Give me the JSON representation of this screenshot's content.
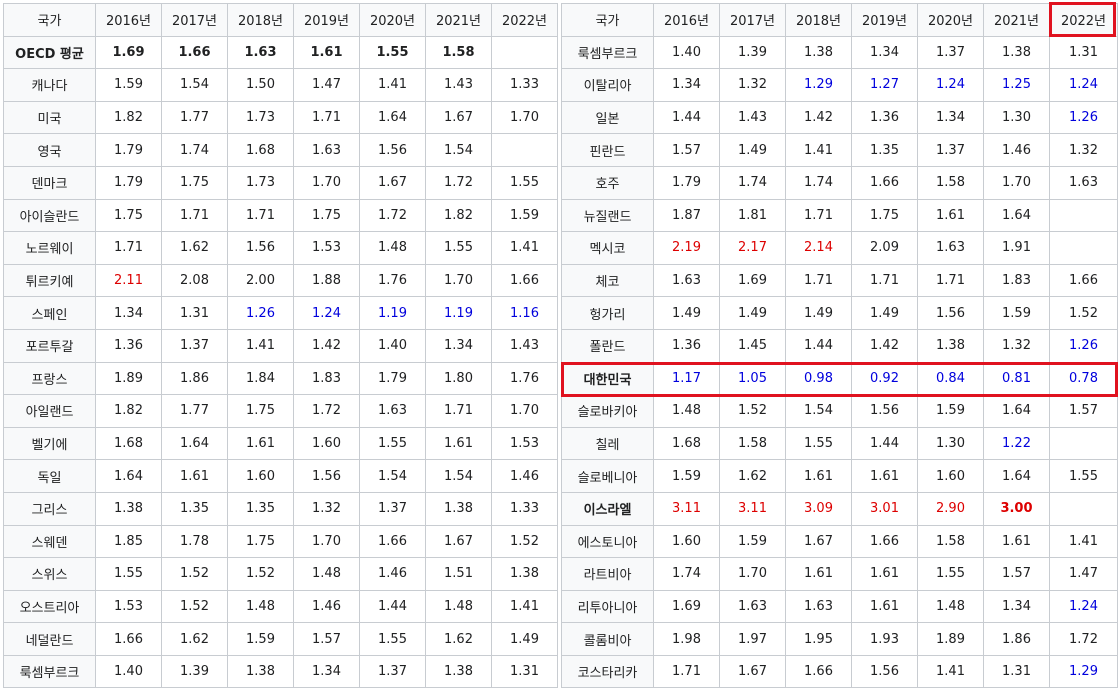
{
  "headers": [
    "국가",
    "2016년",
    "2017년",
    "2018년",
    "2019년",
    "2020년",
    "2021년",
    "2022년"
  ],
  "colors": {
    "red": "#dd0000",
    "blue": "#0000dd",
    "highlight_box": "#e0121f"
  },
  "left_table": [
    {
      "country": "OECD 평균",
      "values": [
        "1.69",
        "1.66",
        "1.63",
        "1.61",
        "1.55",
        "1.58",
        ""
      ],
      "bold": true
    },
    {
      "country": "캐나다",
      "values": [
        "1.59",
        "1.54",
        "1.50",
        "1.47",
        "1.41",
        "1.43",
        "1.33"
      ]
    },
    {
      "country": "미국",
      "values": [
        "1.82",
        "1.77",
        "1.73",
        "1.71",
        "1.64",
        "1.67",
        "1.70"
      ]
    },
    {
      "country": "영국",
      "values": [
        "1.79",
        "1.74",
        "1.68",
        "1.63",
        "1.56",
        "1.54",
        ""
      ]
    },
    {
      "country": "덴마크",
      "values": [
        "1.79",
        "1.75",
        "1.73",
        "1.70",
        "1.67",
        "1.72",
        "1.55"
      ]
    },
    {
      "country": "아이슬란드",
      "values": [
        "1.75",
        "1.71",
        "1.71",
        "1.75",
        "1.72",
        "1.82",
        "1.59"
      ]
    },
    {
      "country": "노르웨이",
      "values": [
        "1.71",
        "1.62",
        "1.56",
        "1.53",
        "1.48",
        "1.55",
        "1.41"
      ]
    },
    {
      "country": "튀르키예",
      "values": [
        "2.11",
        "2.08",
        "2.00",
        "1.88",
        "1.76",
        "1.70",
        "1.66"
      ],
      "colors": [
        "red",
        "",
        "",
        "",
        "",
        "",
        ""
      ]
    },
    {
      "country": "스페인",
      "values": [
        "1.34",
        "1.31",
        "1.26",
        "1.24",
        "1.19",
        "1.19",
        "1.16"
      ],
      "colors": [
        "",
        "",
        "blue",
        "blue",
        "blue",
        "blue",
        "blue"
      ]
    },
    {
      "country": "포르투갈",
      "values": [
        "1.36",
        "1.37",
        "1.41",
        "1.42",
        "1.40",
        "1.34",
        "1.43"
      ]
    },
    {
      "country": "프랑스",
      "values": [
        "1.89",
        "1.86",
        "1.84",
        "1.83",
        "1.79",
        "1.80",
        "1.76"
      ]
    },
    {
      "country": "아일랜드",
      "values": [
        "1.82",
        "1.77",
        "1.75",
        "1.72",
        "1.63",
        "1.71",
        "1.70"
      ]
    },
    {
      "country": "벨기에",
      "values": [
        "1.68",
        "1.64",
        "1.61",
        "1.60",
        "1.55",
        "1.61",
        "1.53"
      ]
    },
    {
      "country": "독일",
      "values": [
        "1.64",
        "1.61",
        "1.60",
        "1.56",
        "1.54",
        "1.54",
        "1.46"
      ]
    },
    {
      "country": "그리스",
      "values": [
        "1.38",
        "1.35",
        "1.35",
        "1.32",
        "1.37",
        "1.38",
        "1.33"
      ]
    },
    {
      "country": "스웨덴",
      "values": [
        "1.85",
        "1.78",
        "1.75",
        "1.70",
        "1.66",
        "1.67",
        "1.52"
      ]
    },
    {
      "country": "스위스",
      "values": [
        "1.55",
        "1.52",
        "1.52",
        "1.48",
        "1.46",
        "1.51",
        "1.38"
      ]
    },
    {
      "country": "오스트리아",
      "values": [
        "1.53",
        "1.52",
        "1.48",
        "1.46",
        "1.44",
        "1.48",
        "1.41"
      ]
    },
    {
      "country": "네덜란드",
      "values": [
        "1.66",
        "1.62",
        "1.59",
        "1.57",
        "1.55",
        "1.62",
        "1.49"
      ]
    },
    {
      "country": "룩셈부르크",
      "values": [
        "1.40",
        "1.39",
        "1.38",
        "1.34",
        "1.37",
        "1.38",
        "1.31"
      ]
    }
  ],
  "right_table": [
    {
      "country": "룩셈부르크",
      "values": [
        "1.40",
        "1.39",
        "1.38",
        "1.34",
        "1.37",
        "1.38",
        "1.31"
      ]
    },
    {
      "country": "이탈리아",
      "values": [
        "1.34",
        "1.32",
        "1.29",
        "1.27",
        "1.24",
        "1.25",
        "1.24"
      ],
      "colors": [
        "",
        "",
        "blue",
        "blue",
        "blue",
        "blue",
        "blue"
      ]
    },
    {
      "country": "일본",
      "values": [
        "1.44",
        "1.43",
        "1.42",
        "1.36",
        "1.34",
        "1.30",
        "1.26"
      ],
      "colors": [
        "",
        "",
        "",
        "",
        "",
        "",
        "blue"
      ]
    },
    {
      "country": "핀란드",
      "values": [
        "1.57",
        "1.49",
        "1.41",
        "1.35",
        "1.37",
        "1.46",
        "1.32"
      ]
    },
    {
      "country": "호주",
      "values": [
        "1.79",
        "1.74",
        "1.74",
        "1.66",
        "1.58",
        "1.70",
        "1.63"
      ]
    },
    {
      "country": "뉴질랜드",
      "values": [
        "1.87",
        "1.81",
        "1.71",
        "1.75",
        "1.61",
        "1.64",
        ""
      ]
    },
    {
      "country": "멕시코",
      "values": [
        "2.19",
        "2.17",
        "2.14",
        "2.09",
        "1.63",
        "1.91",
        ""
      ],
      "colors": [
        "red",
        "red",
        "red",
        "",
        "",
        "",
        ""
      ]
    },
    {
      "country": "체코",
      "values": [
        "1.63",
        "1.69",
        "1.71",
        "1.71",
        "1.71",
        "1.83",
        "1.66"
      ]
    },
    {
      "country": "헝가리",
      "values": [
        "1.49",
        "1.49",
        "1.49",
        "1.49",
        "1.56",
        "1.59",
        "1.52"
      ]
    },
    {
      "country": "폴란드",
      "values": [
        "1.36",
        "1.45",
        "1.44",
        "1.42",
        "1.38",
        "1.32",
        "1.26"
      ],
      "colors": [
        "",
        "",
        "",
        "",
        "",
        "",
        "blue"
      ]
    },
    {
      "country": "대한민국",
      "values": [
        "1.17",
        "1.05",
        "0.98",
        "0.92",
        "0.84",
        "0.81",
        "0.78"
      ],
      "colors": [
        "blue",
        "blue",
        "blue",
        "blue",
        "blue",
        "blue",
        "blue"
      ],
      "bold_name": true
    },
    {
      "country": "슬로바키아",
      "values": [
        "1.48",
        "1.52",
        "1.54",
        "1.56",
        "1.59",
        "1.64",
        "1.57"
      ]
    },
    {
      "country": "칠레",
      "values": [
        "1.68",
        "1.58",
        "1.55",
        "1.44",
        "1.30",
        "1.22",
        ""
      ],
      "colors": [
        "",
        "",
        "",
        "",
        "",
        "blue",
        ""
      ]
    },
    {
      "country": "슬로베니아",
      "values": [
        "1.59",
        "1.62",
        "1.61",
        "1.61",
        "1.60",
        "1.64",
        "1.55"
      ]
    },
    {
      "country": "이스라엘",
      "values": [
        "3.11",
        "3.11",
        "3.09",
        "3.01",
        "2.90",
        "3.00",
        ""
      ],
      "colors": [
        "red",
        "red",
        "red",
        "red",
        "red",
        "red",
        ""
      ],
      "bold_name": true,
      "bold_cells": [
        false,
        false,
        false,
        false,
        false,
        true,
        false
      ]
    },
    {
      "country": "에스토니아",
      "values": [
        "1.60",
        "1.59",
        "1.67",
        "1.66",
        "1.58",
        "1.61",
        "1.41"
      ]
    },
    {
      "country": "라트비아",
      "values": [
        "1.74",
        "1.70",
        "1.61",
        "1.61",
        "1.55",
        "1.57",
        "1.47"
      ]
    },
    {
      "country": "리투아니아",
      "values": [
        "1.69",
        "1.63",
        "1.63",
        "1.61",
        "1.48",
        "1.34",
        "1.24"
      ],
      "colors": [
        "",
        "",
        "",
        "",
        "",
        "",
        "blue"
      ]
    },
    {
      "country": "콜롬비아",
      "values": [
        "1.98",
        "1.97",
        "1.95",
        "1.93",
        "1.89",
        "1.86",
        "1.72"
      ]
    },
    {
      "country": "코스타리카",
      "values": [
        "1.71",
        "1.67",
        "1.66",
        "1.56",
        "1.41",
        "1.31",
        "1.29"
      ],
      "colors": [
        "",
        "",
        "",
        "",
        "",
        "",
        "blue"
      ]
    }
  ]
}
